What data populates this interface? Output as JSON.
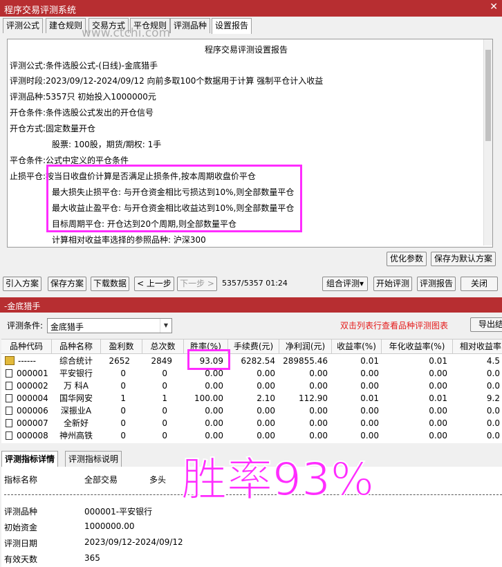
{
  "window": {
    "title": "程序交易评测系统",
    "close": "✕"
  },
  "tabs": [
    "评测公式",
    "建仓规则",
    "交易方式",
    "平仓规则",
    "评测品种",
    "设置报告"
  ],
  "watermark": "www.ctchi.com",
  "report": {
    "title": "程序交易评测设置报告",
    "lines": [
      {
        "label": "评测公式:",
        "value": "条件选股公式-(日线)-金底猎手"
      },
      {
        "label": "评测时段:",
        "value": "2023/09/12-2024/09/12 向前多取100个数据用于计算 强制平仓计入收益"
      },
      {
        "label": "评测品种:",
        "value": "5357只 初始投入1000000元"
      },
      {
        "label": "开仓条件:",
        "value": "条件选股公式发出的开仓信号"
      },
      {
        "label": "开仓方式:",
        "value": "固定数量开仓"
      },
      {
        "label": "",
        "value": "股票: 100股，期货/期权: 1手"
      },
      {
        "label": "平仓条件:",
        "value": "公式中定义的平仓条件"
      },
      {
        "label": "止损平仓:",
        "value": "按当日收盘价计算是否满足止损条件,按本周期收盘价平仓"
      },
      {
        "label": "",
        "value": "最大损失止损平仓: 与开仓资金相比亏损达到10%,则全部数量平仓"
      },
      {
        "label": "",
        "value": "最大收益止盈平仓: 与开仓资金相比收益达到10%,则全部数量平仓"
      },
      {
        "label": "",
        "value": "目标周期平仓: 开仓达到20个周期,则全部数量平仓"
      },
      {
        "label": "",
        "value": "计算相对收益率选择的参照品种: 沪深300"
      }
    ]
  },
  "buttons_top": {
    "optimize": "优化参数",
    "save_default": "保存为默认方案"
  },
  "toolbar": {
    "import": "引入方案",
    "save": "保存方案",
    "download": "下载数据",
    "prev": "< 上一步",
    "next": "下一步 >",
    "progress": "5357/5357 01:24",
    "combo_eval": "组合评测",
    "combo_arrow": "▾",
    "start": "开始评测",
    "report": "评测报告",
    "close": "关闭"
  },
  "section": {
    "title": "-金底猎手"
  },
  "condition": {
    "label": "评测条件:",
    "value": "金底猎手",
    "arrow": "▼",
    "hint": "双击列表行查看品种评测图表",
    "export": "导出结"
  },
  "table": {
    "headers": [
      "品种代码",
      "品种名称",
      "盈利数",
      "总次数",
      "胜率(%)",
      "手续费(元)",
      "净利润(元)",
      "收益率(%)",
      "年化收益率(%)",
      "相对收益率"
    ],
    "rows": [
      [
        "------",
        "综合统计",
        "2652",
        "2849",
        "93.09",
        "6282.54",
        "289855.46",
        "0.01",
        "0.01",
        "4.5"
      ],
      [
        "000001",
        "平安银行",
        "0",
        "0",
        "0.00",
        "0.00",
        "0.00",
        "0.00",
        "0.00",
        "0.0"
      ],
      [
        "000002",
        "万 科A",
        "0",
        "0",
        "0.00",
        "0.00",
        "0.00",
        "0.00",
        "0.00",
        "0.0"
      ],
      [
        "000004",
        "国华网安",
        "1",
        "1",
        "100.00",
        "2.10",
        "112.90",
        "0.01",
        "0.01",
        "9.2"
      ],
      [
        "000006",
        "深振业A",
        "0",
        "0",
        "0.00",
        "0.00",
        "0.00",
        "0.00",
        "0.00",
        "0.0"
      ],
      [
        "000007",
        "全新好",
        "0",
        "0",
        "0.00",
        "0.00",
        "0.00",
        "0.00",
        "0.00",
        "0.0"
      ],
      [
        "000008",
        "神州高铁",
        "0",
        "0",
        "0.00",
        "0.00",
        "0.00",
        "0.00",
        "0.00",
        "0.0"
      ]
    ]
  },
  "bottom_tabs": [
    "评测指标详情",
    "评测指标说明"
  ],
  "detail": {
    "headers": [
      "指标名称",
      "全部交易",
      "多头"
    ],
    "rows": [
      {
        "k": "评测品种",
        "v": "000001-平安银行"
      },
      {
        "k": "初始资金",
        "v": "1000000.00"
      },
      {
        "k": "评测日期",
        "v": "2023/09/12-2024/09/12"
      },
      {
        "k": "有效天数",
        "v": "365"
      }
    ]
  },
  "overlay": {
    "text": "胜率93%"
  },
  "colors": {
    "titlebar": "#b72e31",
    "highlight": "#ff2cff",
    "hint": "#e41b1b"
  }
}
